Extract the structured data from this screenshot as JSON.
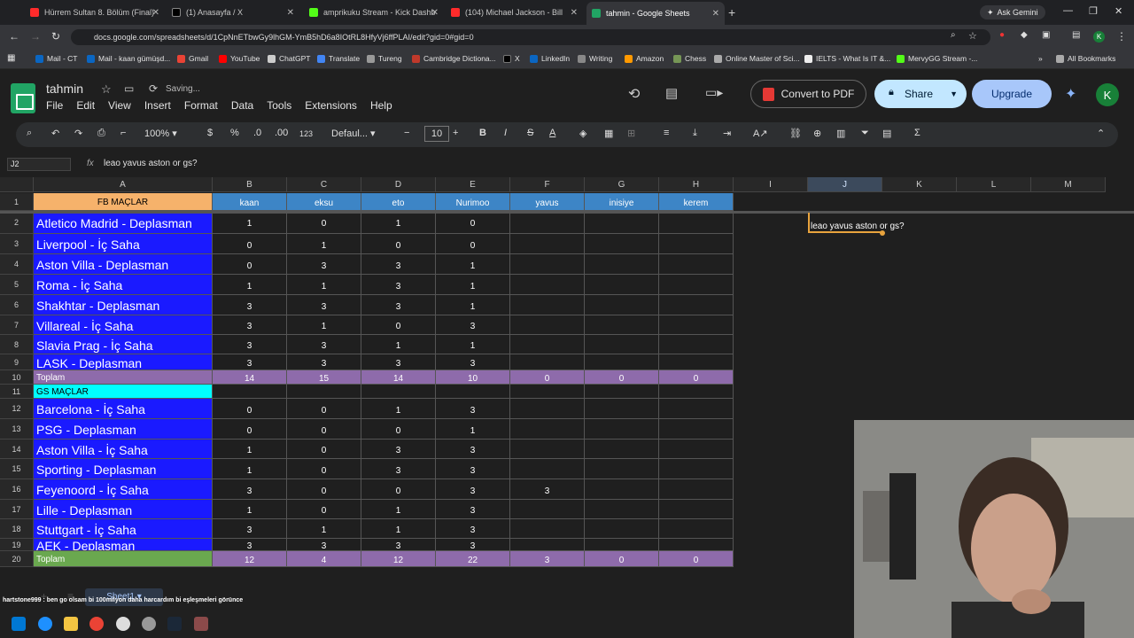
{
  "browser": {
    "tabs": [
      {
        "label": "Hürrem Sultan 8. Bölüm (Final)",
        "color": "#ff2b2b"
      },
      {
        "label": "(1) Anasayfa / X",
        "color": "#000000"
      },
      {
        "label": "amprikuku Stream - Kick Dashb",
        "color": "#53fc18"
      },
      {
        "label": "(104) Michael Jackson - Bill",
        "color": "#ff2b2b"
      },
      {
        "label": "tahmin - Google Sheets",
        "color": "#21a464"
      }
    ],
    "ask_gemini": "Ask Gemini",
    "url": "docs.google.com/spreadsheets/d/1CpNnETbwGy9lhGM-YmB5hD6a8IOtRL8HfyVj6ffPLAI/edit?gid=0#gid=0",
    "bookmarks": [
      "Mail - CT",
      "Mail - kaan gümüşd...",
      "Gmail",
      "YouTube",
      "ChatGPT",
      "Translate",
      "Tureng",
      "Cambridge Dictiona...",
      "X",
      "LinkedIn",
      "Writing",
      "Amazon",
      "Chess",
      "Online Master of Sci...",
      "IELTS - What Is IT &...",
      "MervyGG Stream -..."
    ],
    "all_bookmarks": "All Bookmarks"
  },
  "sheets": {
    "title": "tahmin",
    "status": "Saving...",
    "menu": [
      "File",
      "Edit",
      "View",
      "Insert",
      "Format",
      "Data",
      "Tools",
      "Extensions",
      "Help"
    ],
    "convert_pdf": "Convert to PDF",
    "share": "Share",
    "upgrade": "Upgrade",
    "avatar": "K",
    "toolbar": {
      "zoom": "100%",
      "currency": "$",
      "percent": "%",
      "dec_less": ".0",
      "dec_more": ".00",
      "numfmt": "123",
      "font": "Defaul...",
      "font_size": "10",
      "bold": "B",
      "italic": "I",
      "strike": "S",
      "textcolor": "A"
    },
    "cell_ref": "J2",
    "formula": "leao yavus aston or gs?"
  },
  "grid": {
    "columns": [
      "A",
      "B",
      "C",
      "D",
      "E",
      "F",
      "G",
      "H",
      "I",
      "J",
      "K",
      "L",
      "M"
    ],
    "row_numbers": [
      "1",
      "2",
      "3",
      "4",
      "5",
      "6",
      "7",
      "8",
      "9",
      "10",
      "11",
      "12",
      "13",
      "14",
      "15",
      "16",
      "17",
      "18",
      "19",
      "20"
    ],
    "header": [
      "FB MAÇLAR",
      "kaan",
      "eksu",
      "eto",
      "Nurimoo",
      "yavus",
      "inisiye",
      "kerem"
    ],
    "fb_rows": [
      [
        "Atletico Madrid - Deplasman",
        "1",
        "0",
        "1",
        "0",
        "",
        "",
        ""
      ],
      [
        "Liverpool - İç Saha",
        "0",
        "1",
        "0",
        "0",
        "",
        "",
        ""
      ],
      [
        "Aston Villa - Deplasman",
        "0",
        "3",
        "3",
        "1",
        "",
        "",
        ""
      ],
      [
        "Roma - İç Saha",
        "1",
        "1",
        "3",
        "1",
        "",
        "",
        ""
      ],
      [
        "Shakhtar - Deplasman",
        "3",
        "3",
        "3",
        "1",
        "",
        "",
        ""
      ],
      [
        "Villareal - İç Saha",
        "3",
        "1",
        "0",
        "3",
        "",
        "",
        ""
      ],
      [
        "Slavia Prag - İç Saha",
        "3",
        "3",
        "1",
        "1",
        "",
        "",
        ""
      ],
      [
        "LASK - Deplasman",
        "3",
        "3",
        "3",
        "3",
        "",
        "",
        ""
      ]
    ],
    "fb_total": [
      "Toplam",
      "14",
      "15",
      "14",
      "10",
      "0",
      "0",
      "0"
    ],
    "gs_header": "GS MAÇLAR",
    "gs_rows": [
      [
        "Barcelona - İç Saha",
        "0",
        "0",
        "1",
        "3",
        "",
        "",
        ""
      ],
      [
        "PSG - Deplasman",
        "0",
        "0",
        "0",
        "1",
        "",
        "",
        ""
      ],
      [
        "Aston Villa - İç Saha",
        "1",
        "0",
        "3",
        "3",
        "",
        "",
        ""
      ],
      [
        "Sporting - Deplasman",
        "1",
        "0",
        "3",
        "3",
        "",
        "",
        ""
      ],
      [
        "Feyenoord - İç Saha",
        "3",
        "0",
        "0",
        "3",
        "3",
        "",
        ""
      ],
      [
        "Lille - Deplasman",
        "1",
        "0",
        "1",
        "3",
        "",
        "",
        ""
      ],
      [
        "Stuttgart - İç Saha",
        "3",
        "1",
        "1",
        "3",
        "",
        "",
        ""
      ],
      [
        "AEK - Deplasman",
        "3",
        "3",
        "3",
        "3",
        "",
        "",
        ""
      ]
    ],
    "gs_total": [
      "Toplam",
      "12",
      "4",
      "12",
      "22",
      "3",
      "0",
      "0"
    ],
    "j2_text": "leao yavus aston or gs?"
  },
  "bottom": {
    "sheet_tab": "Sheet1",
    "chat": "hartstone999 : ben go olsam bi 100milyon daha harcardım bi eşleşmeleri görünce"
  },
  "colors": {
    "team_bg": "#1a1aff",
    "header_orange": "#f6b26b",
    "header_blue": "#3d85c6",
    "total_purple": "#8e6bab",
    "gs_cyan": "#00ffff"
  }
}
